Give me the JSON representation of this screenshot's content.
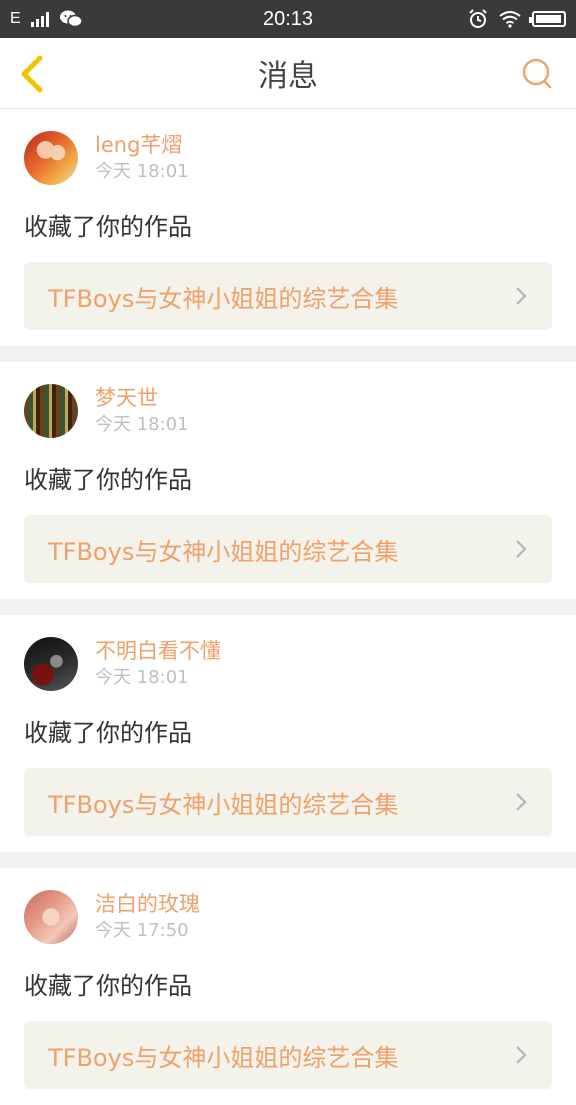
{
  "status_bar": {
    "network": "E",
    "time": "20:13",
    "battery_level": 0.95
  },
  "header": {
    "title": "消息"
  },
  "messages": [
    {
      "user": "leng芊熠",
      "time": "今天 18:01",
      "action": "收藏了你的作品",
      "work": "TFBoys与女神小姐姐的综艺合集"
    },
    {
      "user": "梦天世",
      "time": "今天 18:01",
      "action": "收藏了你的作品",
      "work": "TFBoys与女神小姐姐的综艺合集"
    },
    {
      "user": "不明白看不懂",
      "time": "今天 18:01",
      "action": "收藏了你的作品",
      "work": "TFBoys与女神小姐姐的综艺合集"
    },
    {
      "user": "洁白的玫瑰",
      "time": "今天 17:50",
      "action": "收藏了你的作品",
      "work": "TFBoys与女神小姐姐的综艺合集"
    }
  ],
  "colors": {
    "accent": "#f0a06a",
    "back_arrow": "#f5c400",
    "link_bg": "#f3f3ec"
  }
}
